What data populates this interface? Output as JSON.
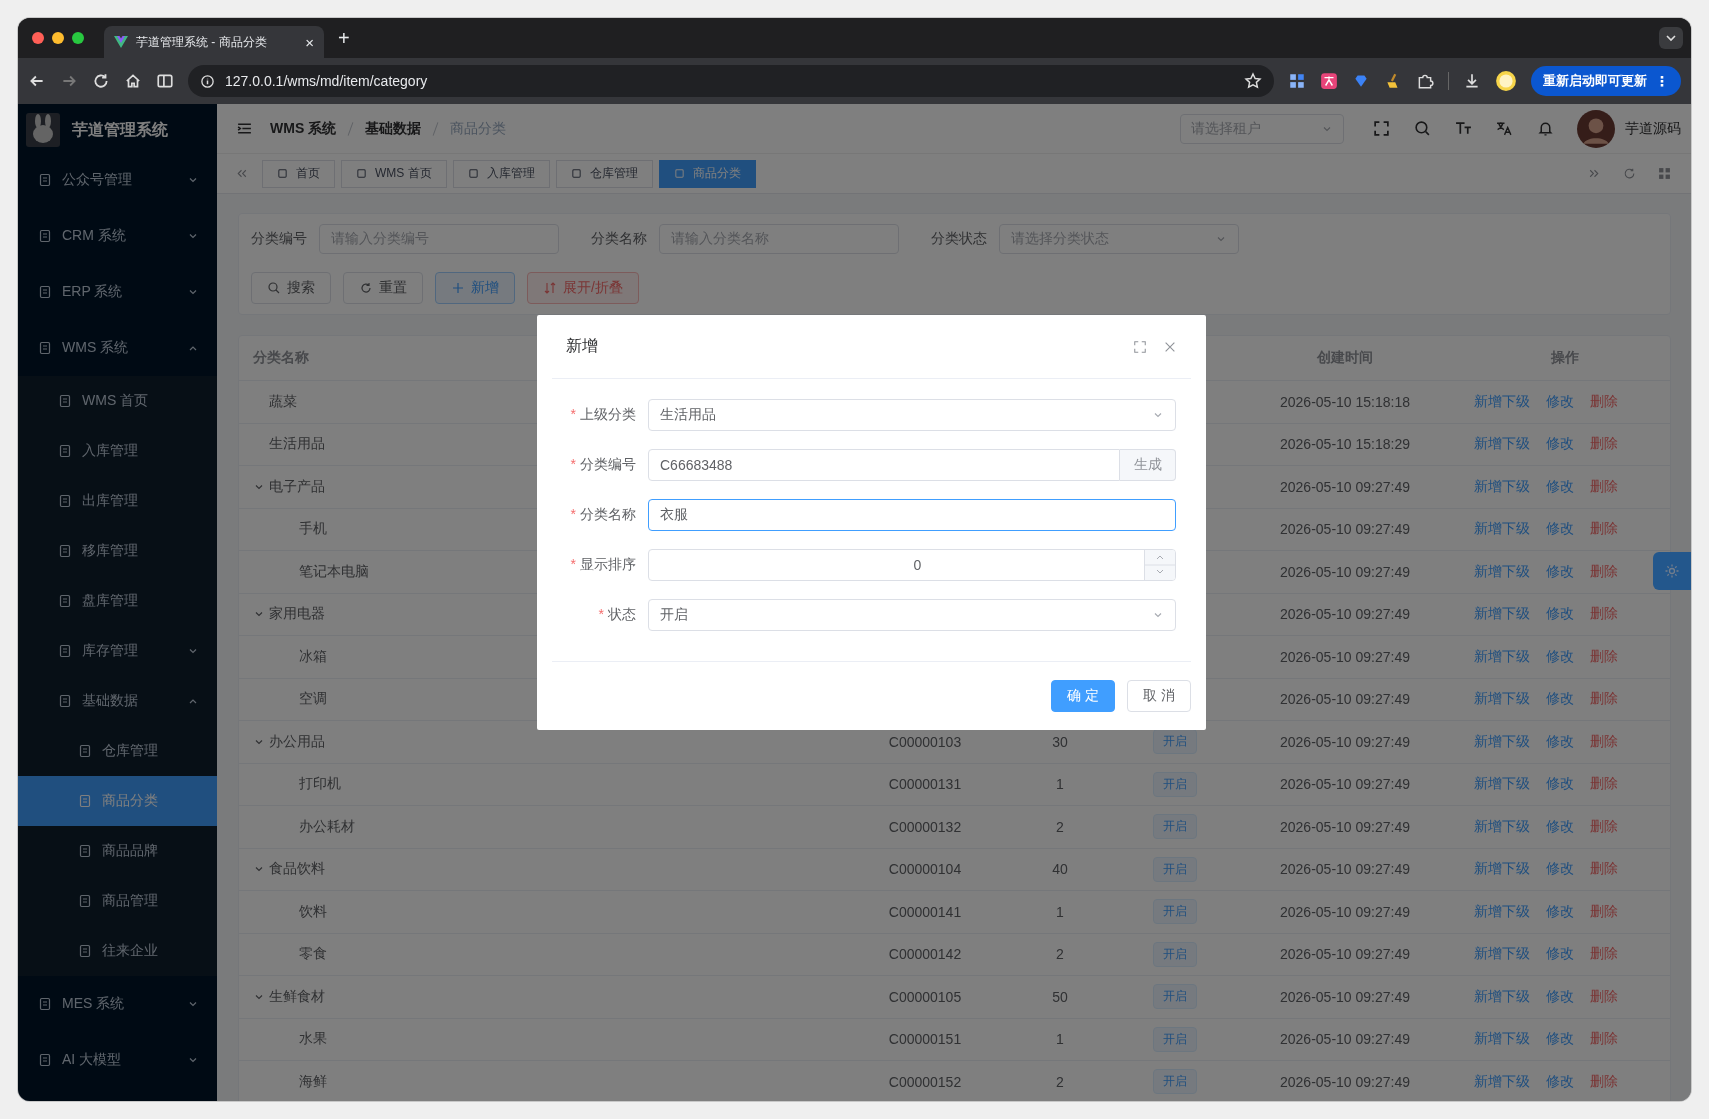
{
  "browser": {
    "tab_title": "芋道管理系统 - 商品分类",
    "tab_close": "×",
    "new_tab": "+",
    "url": "127.0.0.1/wms/md/item/category",
    "update_button": "重新启动即可更新",
    "update_menu": "⋮"
  },
  "app": {
    "title": "芋道管理系统"
  },
  "sidebar": {
    "items": [
      {
        "label": "公众号管理",
        "expanded": false,
        "selected": false
      },
      {
        "label": "CRM 系统",
        "expanded": false,
        "selected": false
      },
      {
        "label": "ERP 系统",
        "expanded": false,
        "selected": false
      },
      {
        "label": "WMS 系统",
        "expanded": true,
        "selected": false,
        "children": [
          {
            "label": "WMS 首页",
            "selected": false
          },
          {
            "label": "入库管理",
            "selected": false
          },
          {
            "label": "出库管理",
            "selected": false
          },
          {
            "label": "移库管理",
            "selected": false
          },
          {
            "label": "盘库管理",
            "selected": false
          },
          {
            "label": "库存管理",
            "expanded": false,
            "selected": false
          },
          {
            "label": "基础数据",
            "expanded": true,
            "selected": false,
            "children": [
              {
                "label": "仓库管理",
                "selected": false
              },
              {
                "label": "商品分类",
                "selected": true
              },
              {
                "label": "商品品牌",
                "selected": false
              },
              {
                "label": "商品管理",
                "selected": false
              },
              {
                "label": "往来企业",
                "selected": false
              }
            ]
          }
        ]
      },
      {
        "label": "MES 系统",
        "expanded": false,
        "selected": false
      },
      {
        "label": "AI 大模型",
        "expanded": false,
        "selected": false
      }
    ]
  },
  "navbar": {
    "breadcrumb": [
      {
        "label": "WMS 系统",
        "current": false
      },
      {
        "label": "基础数据",
        "current": false
      },
      {
        "label": "商品分类",
        "current": true
      }
    ],
    "tenant_placeholder": "请选择租户",
    "user_name": "芋道源码"
  },
  "tags": [
    {
      "label": "首页",
      "selected": false
    },
    {
      "label": "WMS 首页",
      "selected": false
    },
    {
      "label": "入库管理",
      "selected": false
    },
    {
      "label": "仓库管理",
      "selected": false
    },
    {
      "label": "商品分类",
      "selected": true
    }
  ],
  "search_form": {
    "fields": [
      {
        "label": "分类编号",
        "placeholder": "请输入分类编号",
        "kind": "input"
      },
      {
        "label": "分类名称",
        "placeholder": "请输入分类名称",
        "kind": "input"
      },
      {
        "label": "分类状态",
        "placeholder": "请选择分类状态",
        "kind": "select"
      }
    ],
    "buttons": [
      {
        "label": "搜索",
        "kind": "default"
      },
      {
        "label": "重置",
        "kind": "default"
      },
      {
        "label": "新增",
        "kind": "primary"
      },
      {
        "label": "展开/折叠",
        "kind": "danger"
      }
    ]
  },
  "table": {
    "columns": {
      "name": "分类名称",
      "created": "创建时间",
      "actions": "操作"
    },
    "rows": [
      {
        "name": "蔬菜",
        "created": "2026-05-10 15:18:18",
        "actions": [
          "新增下级",
          "修改",
          "删除"
        ]
      },
      {
        "name": "生活用品",
        "created": "2026-05-10 15:18:29",
        "actions": [
          "新增下级",
          "修改",
          "删除"
        ]
      },
      {
        "name": "电子产品",
        "expanded": true,
        "created": "2026-05-10 09:27:49",
        "actions": [
          "新增下级",
          "修改",
          "删除"
        ],
        "children": [
          {
            "name": "手机",
            "created": "2026-05-10 09:27:49",
            "actions": [
              "新增下级",
              "修改",
              "删除"
            ]
          },
          {
            "name": "笔记本电脑",
            "created": "2026-05-10 09:27:49",
            "actions": [
              "新增下级",
              "修改",
              "删除"
            ]
          }
        ]
      },
      {
        "name": "家用电器",
        "expanded": true,
        "created": "2026-05-10 09:27:49",
        "actions": [
          "新增下级",
          "修改",
          "删除"
        ],
        "children": [
          {
            "name": "冰箱",
            "created": "2026-05-10 09:27:49",
            "actions": [
              "新增下级",
              "修改",
              "删除"
            ]
          },
          {
            "name": "空调",
            "created": "2026-05-10 09:27:49",
            "actions": [
              "新增下级",
              "修改",
              "删除"
            ]
          }
        ]
      },
      {
        "name": "办公用品",
        "expanded": true,
        "code": "C00000103",
        "sort": "30",
        "status": "开启",
        "created": "2026-05-10 09:27:49",
        "actions": [
          "新增下级",
          "修改",
          "删除"
        ],
        "children": [
          {
            "name": "打印机",
            "code": "C00000131",
            "sort": "1",
            "status": "开启",
            "created": "2026-05-10 09:27:49",
            "actions": [
              "新增下级",
              "修改",
              "删除"
            ]
          },
          {
            "name": "办公耗材",
            "code": "C00000132",
            "sort": "2",
            "status": "开启",
            "created": "2026-05-10 09:27:49",
            "actions": [
              "新增下级",
              "修改",
              "删除"
            ]
          }
        ]
      },
      {
        "name": "食品饮料",
        "expanded": true,
        "code": "C00000104",
        "sort": "40",
        "status": "开启",
        "created": "2026-05-10 09:27:49",
        "actions": [
          "新增下级",
          "修改",
          "删除"
        ],
        "children": [
          {
            "name": "饮料",
            "code": "C00000141",
            "sort": "1",
            "status": "开启",
            "created": "2026-05-10 09:27:49",
            "actions": [
              "新增下级",
              "修改",
              "删除"
            ]
          },
          {
            "name": "零食",
            "code": "C00000142",
            "sort": "2",
            "status": "开启",
            "created": "2026-05-10 09:27:49",
            "actions": [
              "新增下级",
              "修改",
              "删除"
            ]
          }
        ]
      },
      {
        "name": "生鲜食材",
        "expanded": true,
        "code": "C00000105",
        "sort": "50",
        "status": "开启",
        "created": "2026-05-10 09:27:49",
        "actions": [
          "新增下级",
          "修改",
          "删除"
        ],
        "children": [
          {
            "name": "水果",
            "code": "C00000151",
            "sort": "1",
            "status": "开启",
            "created": "2026-05-10 09:27:49",
            "actions": [
              "新增下级",
              "修改",
              "删除"
            ]
          },
          {
            "name": "海鲜",
            "code": "C00000152",
            "sort": "2",
            "status": "开启",
            "created": "2026-05-10 09:27:49",
            "actions": [
              "新增下级",
              "修改",
              "删除"
            ]
          }
        ]
      }
    ]
  },
  "dialog": {
    "title": "新增",
    "fields": [
      {
        "label": "上级分类",
        "required_mark": "*",
        "kind": "select",
        "value": "生活用品",
        "focused": false
      },
      {
        "label": "分类编号",
        "required_mark": "*",
        "kind": "append",
        "value": "C66683488",
        "append": "生成",
        "focused": false
      },
      {
        "label": "分类名称",
        "required_mark": "*",
        "kind": "input",
        "value": "衣服",
        "focused": true
      },
      {
        "label": "显示排序",
        "required_mark": "*",
        "kind": "number",
        "value": "0",
        "focused": false
      },
      {
        "label": "状态",
        "required_mark": "*",
        "kind": "select",
        "value": "开启",
        "focused": false
      }
    ],
    "buttons": [
      {
        "label": "确 定",
        "kind": "primary"
      },
      {
        "label": "取 消",
        "kind": "default"
      }
    ]
  }
}
